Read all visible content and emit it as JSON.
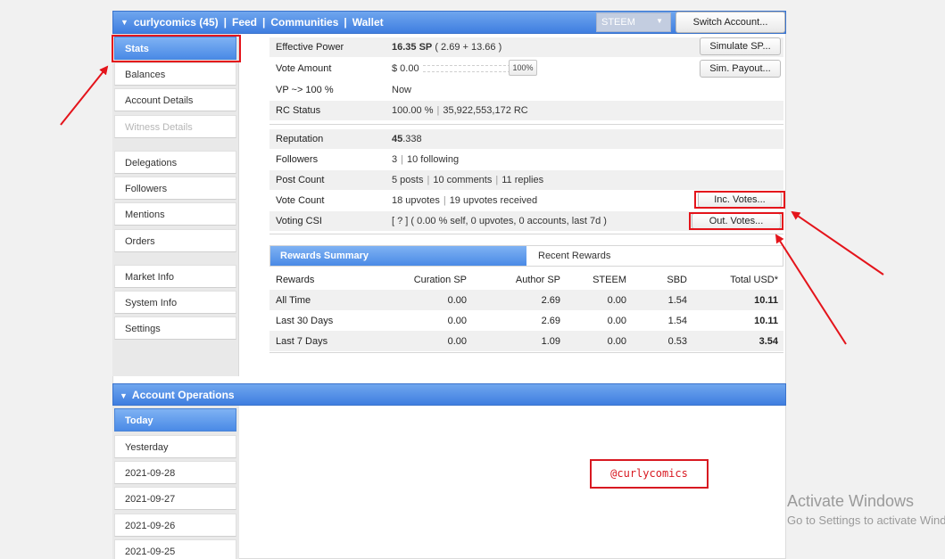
{
  "topbar": {
    "account": "curlycomics (45)",
    "feed": "Feed",
    "communities": "Communities",
    "wallet": "Wallet",
    "token_select": "STEEM",
    "switch_account": "Switch Account..."
  },
  "sidebar": {
    "items": [
      "Stats",
      "Balances",
      "Account Details",
      "Witness Details",
      "Delegations",
      "Followers",
      "Mentions",
      "Orders",
      "Market Info",
      "System Info",
      "Settings"
    ]
  },
  "stats": {
    "effective_power_label": "Effective Power",
    "effective_power_value": "16.35 SP",
    "effective_power_detail": " ( 2.69 + 13.66 )",
    "simulate_sp": "Simulate SP...",
    "vote_amount_label": "Vote Amount",
    "vote_amount_value": "$ 0.00",
    "vote_slider_percent": "100%",
    "sim_payout": "Sim. Payout...",
    "vp_label": "VP ~> 100 %",
    "vp_value": "Now",
    "rc_label": "RC Status",
    "rc_percent": "100.00 %",
    "rc_amount": "35,922,553,172 RC",
    "reputation_label": "Reputation",
    "reputation_int": "45",
    "reputation_dec": ".338",
    "followers_label": "Followers",
    "followers_count": "3",
    "following": "10 following",
    "postcount_label": "Post Count",
    "posts": "5 posts",
    "comments": "10 comments",
    "replies": "11 replies",
    "votecount_label": "Vote Count",
    "upvotes": "18 upvotes",
    "upvotes_received": "19 upvotes received",
    "inc_votes": "Inc. Votes...",
    "csi_label": "Voting CSI",
    "csi_value": "[ ? ] ( 0.00 % self, 0 upvotes, 0 accounts, last 7d )",
    "out_votes": "Out. Votes..."
  },
  "rewards": {
    "tab_summary": "Rewards Summary",
    "tab_recent": "Recent Rewards",
    "headers": [
      "Rewards",
      "Curation SP",
      "Author SP",
      "STEEM",
      "SBD",
      "Total USD*"
    ],
    "rows": [
      [
        "All Time",
        "0.00",
        "2.69",
        "0.00",
        "1.54",
        "10.11"
      ],
      [
        "Last 30 Days",
        "0.00",
        "2.69",
        "0.00",
        "1.54",
        "10.11"
      ],
      [
        "Last 7 Days",
        "0.00",
        "1.09",
        "0.00",
        "0.53",
        "3.54"
      ]
    ]
  },
  "operations": {
    "title": "Account Operations",
    "days": [
      "Today",
      "Yesterday",
      "2021-09-28",
      "2021-09-27",
      "2021-09-26",
      "2021-09-25"
    ]
  },
  "annotation": {
    "handle": "@curlycomics",
    "color": "#e4141b"
  },
  "watermark": {
    "line1": "Activate Windows",
    "line2": "Go to Settings to activate Windows."
  }
}
